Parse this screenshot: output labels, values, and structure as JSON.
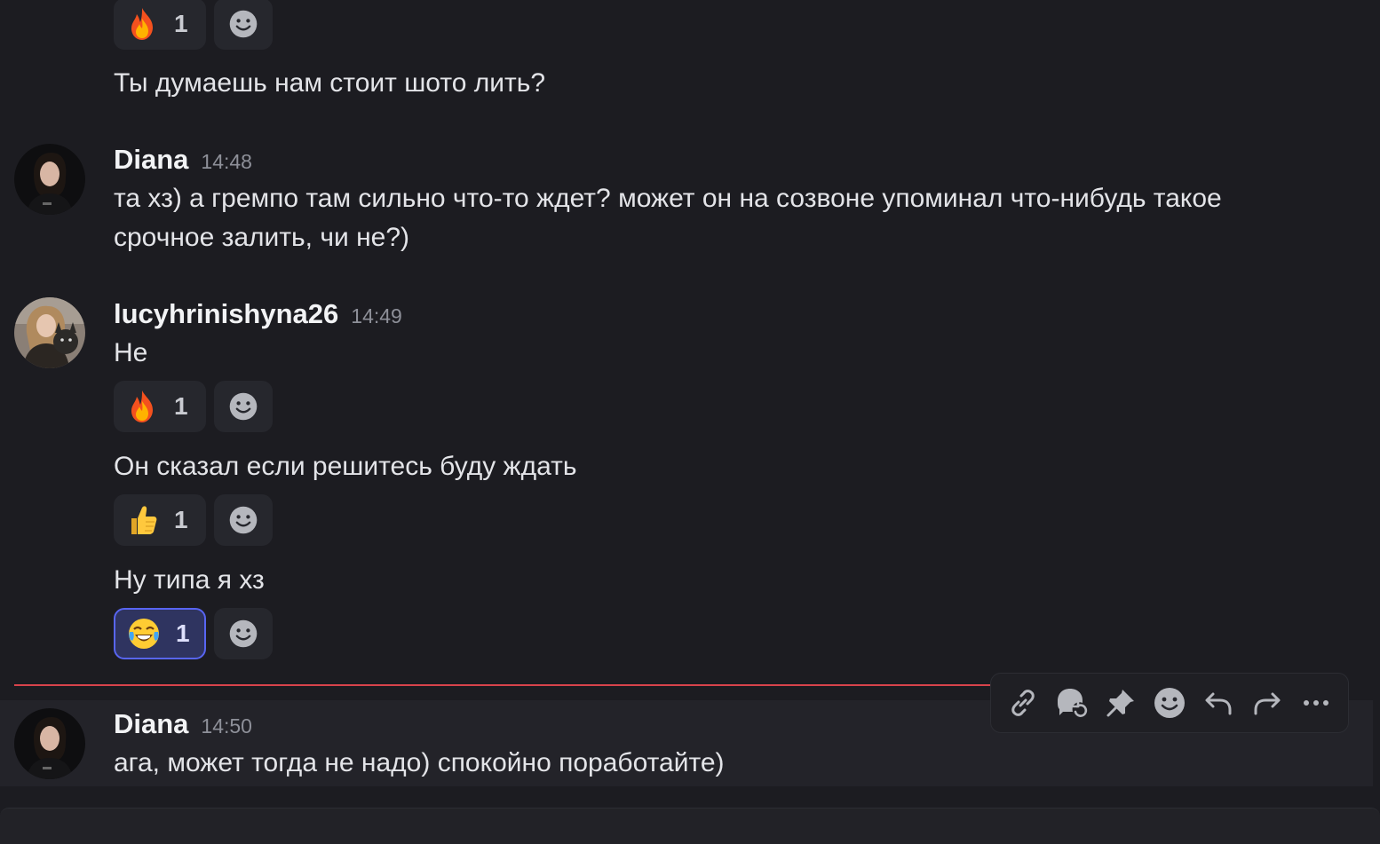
{
  "messages_top": {
    "reaction_fire_top": {
      "emoji": "fire",
      "count": "1"
    },
    "text_1": "Ты думаешь нам стоит шото лить?"
  },
  "msg_diana_1": {
    "author": "Diana",
    "time": "14:48",
    "line1": "та хз) а гремпо там сильно что-то ждет? может он на созвоне упоминал что-нибудь такое",
    "line2": "срочное залить, чи не?)"
  },
  "msg_lucy": {
    "author": "lucyhrinishyna26",
    "time": "14:49",
    "text_1": "Не",
    "reaction_1": {
      "emoji": "fire",
      "count": "1"
    },
    "text_2": "Он сказал если решитесь буду ждать",
    "reaction_2": {
      "emoji": "thumbs-up",
      "count": "1"
    },
    "text_3": "Ну типа я хз",
    "reaction_3": {
      "emoji": "joy",
      "count": "1"
    }
  },
  "msg_diana_2": {
    "author": "Diana",
    "time": "14:50",
    "text": "ага, может тогда не надо) спокойно поработайте)"
  },
  "toolbar": {
    "icons": [
      "link-icon",
      "thread-icon",
      "pin-icon",
      "add-reaction-icon",
      "reply-icon",
      "forward-icon",
      "more-icon"
    ]
  },
  "colors": {
    "background": "#1c1c21",
    "new_message_divider": "#d8434b",
    "active_reaction_border": "#5865f2"
  }
}
